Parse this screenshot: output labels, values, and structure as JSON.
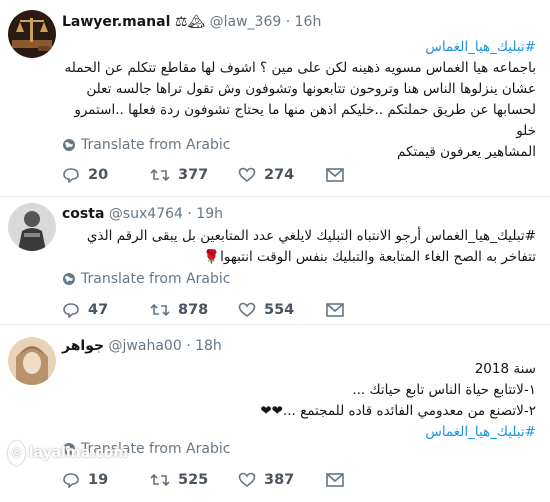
{
  "tweets": [
    {
      "name": "Lawyer.manal",
      "name_emoji": "⚖🏔",
      "handle": "@law_369",
      "time": "16h",
      "hashtag": "#تبليك_هيا_الغماس",
      "lines": [
        "باجماعه هيا الغماس مسويه ذهينه لكن على مين ؟ اشوف لها مقاطع تتكلم عن الحمله",
        "عشان ينزلوها الناس هنا وتروحون تتابعونها وتشوفون وش تقول تراها جالسه تعلن",
        "لحسابها عن طريق حملتكم ..خليكم اذهن منها ما يحتاج تشوفون ردة فعلها ..استمرو خلو",
        "المشاهير يعرفون قيمتكم"
      ],
      "translate": "Translate from Arabic",
      "replies": "20",
      "retweets": "377",
      "likes": "274"
    },
    {
      "name": "costa",
      "handle": "@sux4764",
      "time": "19h",
      "lines": [
        "#تبليك_هيا_الغماس أرجو الانتباه التبليك لايلغي عدد المتابعين بل يبقى الرقم الذي",
        "تتفاخر به الصح الغاء المتابعة والتبليك بنفس الوقت انتبهوا🌹"
      ],
      "translate": "Translate from Arabic",
      "replies": "47",
      "retweets": "878",
      "likes": "554"
    },
    {
      "name": "جواهر",
      "handle": "@jwaha00",
      "time": "18h",
      "lines": [
        "سنة 2018",
        "١-لاتتابع حياة الناس تابع حياتك ...",
        "٢-لاتصنع من معدومي الفائده قاده للمجتمع ...❤❤"
      ],
      "hashtag": "#تبليك_هيا_الغماس",
      "translate": "Translate from Arabic",
      "replies": "19",
      "retweets": "525",
      "likes": "387"
    }
  ],
  "watermark": "layalina.com",
  "icons": [
    "globe-icon",
    "reply-icon",
    "retweet-icon",
    "like-icon",
    "mail-icon"
  ],
  "colors": {
    "link": "#1b95e0",
    "muted": "#657786",
    "border": "#e6ecf0"
  }
}
